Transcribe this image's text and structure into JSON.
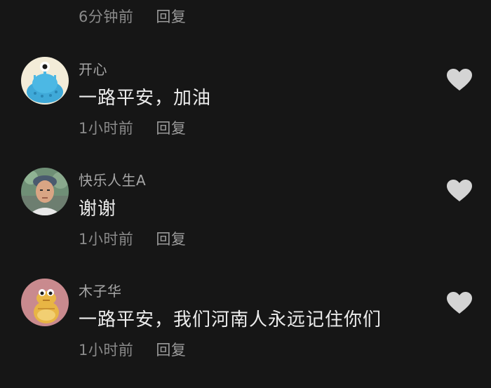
{
  "top_comment": {
    "time": "6分钟前",
    "reply": "回复"
  },
  "comments": [
    {
      "username": "开心",
      "text": "一路平安，加油",
      "time": "1小时前",
      "reply": "回复",
      "avatar_icon": "cartoon-blue-creature-icon",
      "like_icon": "heart-icon"
    },
    {
      "username": "快乐人生A",
      "text": "谢谢",
      "time": "1小时前",
      "reply": "回复",
      "avatar_icon": "person-photo-icon",
      "like_icon": "heart-icon"
    },
    {
      "username": "木子华",
      "text": "一路平安，我们河南人永远记住你们",
      "time": "1小时前",
      "reply": "回复",
      "avatar_icon": "cartoon-yellow-creature-icon",
      "like_icon": "heart-icon"
    }
  ],
  "colors": {
    "background": "#161616",
    "username": "#a6a6a6",
    "text": "#ececec",
    "meta": "#8a8a8a",
    "heart": "#d4d4d4"
  }
}
